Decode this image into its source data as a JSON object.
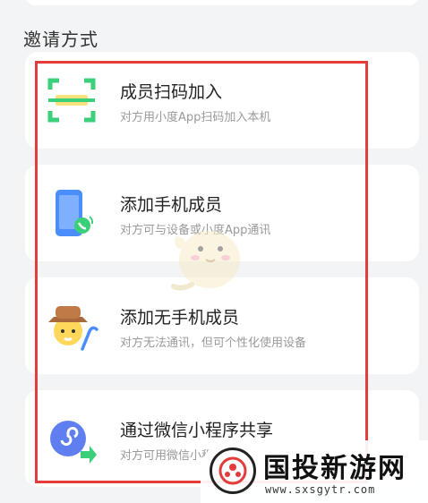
{
  "section": {
    "title": "邀请方式"
  },
  "methods": [
    {
      "title": "成员扫码加入",
      "desc": "对方用小度App扫码加入本机",
      "icon": "scan-icon"
    },
    {
      "title": "添加手机成员",
      "desc": "对方可与设备或小度App通讯",
      "icon": "phone-call-icon"
    },
    {
      "title": "添加无手机成员",
      "desc": "对方无法通讯，但可个性化使用设备",
      "icon": "elder-cane-icon"
    },
    {
      "title": "通过微信小程序共享",
      "desc": "对方可用微信小程序",
      "icon": "mini-program-icon"
    }
  ],
  "watermark": {
    "title": "国投新游网",
    "url": "www.sxsgytr.com"
  },
  "colors": {
    "highlight": "#e43b3b",
    "scan_green": "#3bcf7a",
    "phone_blue": "#4a8dfb"
  }
}
